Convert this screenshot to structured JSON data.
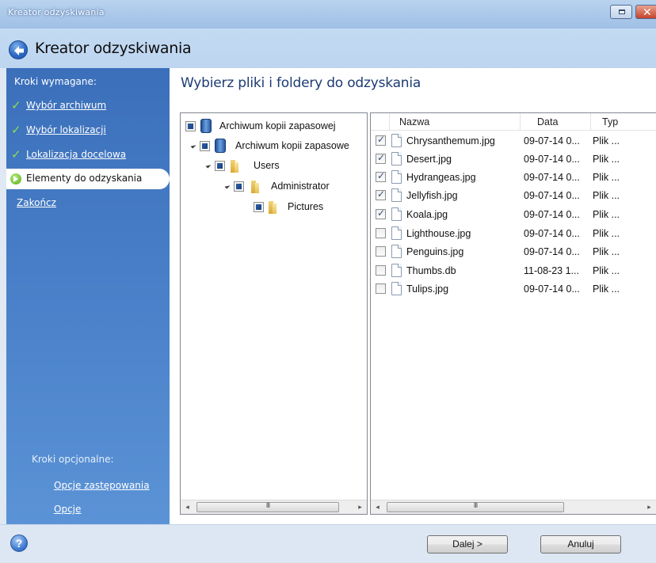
{
  "window": {
    "title": "Kreator odzyskiwania",
    "header_title": "Kreator odzyskiwania"
  },
  "sidebar": {
    "required_heading": "Kroki wymagane:",
    "steps": [
      {
        "label": "Wybór archiwum",
        "state": "done"
      },
      {
        "label": "Wybór lokalizacji",
        "state": "done"
      },
      {
        "label": "Lokalizacja docelowa",
        "state": "done"
      },
      {
        "label": "Elementy do odzyskania",
        "state": "active"
      },
      {
        "label": "Zakończ",
        "state": "pending"
      }
    ],
    "optional_heading": "Kroki opcjonalne:",
    "optional_steps": [
      {
        "label": "Opcje zastępowania"
      },
      {
        "label": "Opcje"
      }
    ]
  },
  "main": {
    "title": "Wybierz pliki i foldery do odzyskania",
    "tree": [
      {
        "label": "Archiwum kopii zapasowej",
        "icon": "database-icon",
        "expanded": null
      },
      {
        "label": "Archiwum kopii zapasowe",
        "icon": "database-icon",
        "expanded": true
      },
      {
        "label": "Users",
        "icon": "folder-icon",
        "expanded": true
      },
      {
        "label": "Administrator",
        "icon": "folder-icon",
        "expanded": true
      },
      {
        "label": "Pictures",
        "icon": "folder-icon",
        "expanded": null
      }
    ],
    "columns": {
      "name": "Nazwa",
      "date": "Data",
      "type": "Typ"
    },
    "files": [
      {
        "name": "Chrysanthemum.jpg",
        "date": "09-07-14 0...",
        "type": "Plik ...",
        "checked": true
      },
      {
        "name": "Desert.jpg",
        "date": "09-07-14 0...",
        "type": "Plik ...",
        "checked": true
      },
      {
        "name": "Hydrangeas.jpg",
        "date": "09-07-14 0...",
        "type": "Plik ...",
        "checked": true
      },
      {
        "name": "Jellyfish.jpg",
        "date": "09-07-14 0...",
        "type": "Plik ...",
        "checked": true
      },
      {
        "name": "Koala.jpg",
        "date": "09-07-14 0...",
        "type": "Plik ...",
        "checked": true
      },
      {
        "name": "Lighthouse.jpg",
        "date": "09-07-14 0...",
        "type": "Plik ...",
        "checked": false
      },
      {
        "name": "Penguins.jpg",
        "date": "09-07-14 0...",
        "type": "Plik ...",
        "checked": false
      },
      {
        "name": "Thumbs.db",
        "date": "11-08-23 1...",
        "type": "Plik ...",
        "checked": false
      },
      {
        "name": "Tulips.jpg",
        "date": "09-07-14 0...",
        "type": "Plik ...",
        "checked": false
      }
    ],
    "scroll_thumb_glyph": "III"
  },
  "footer": {
    "help_glyph": "?",
    "next_label": "Dalej >",
    "cancel_label": "Anuluj"
  },
  "colors": {
    "sidebar": "#4b82ca",
    "title_text": "#1c3b73",
    "check_green": "#8fe04a"
  }
}
